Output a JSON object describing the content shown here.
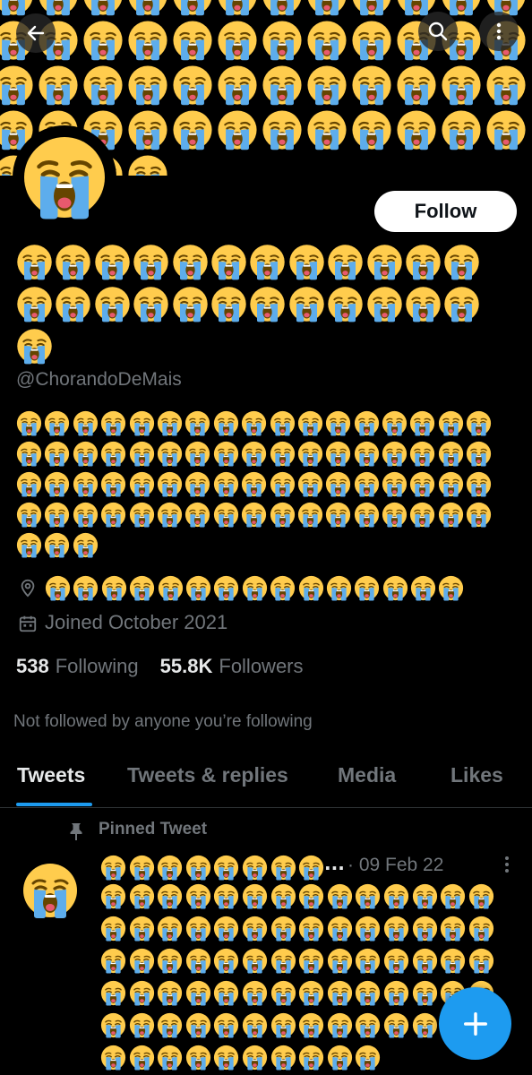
{
  "header": {
    "back_icon": "arrow-left-icon",
    "search_icon": "search-icon",
    "more_icon": "more-vertical-icon",
    "banner_emoji": "😭"
  },
  "profile": {
    "avatar_emoji": "😭",
    "follow_label": "Follow",
    "display_name": "😭😭😭😭😭😭😭😭😭😭😭😭😭😭😭😭😭😭😭😭😭😭😭😭😭",
    "handle": "@ChorandoDeMais",
    "bio": "😭😭😭😭😭😭😭😭😭😭😭😭😭😭😭😭😭😭😭😭😭😭😭😭😭😭😭😭😭😭😭😭😭😭😭😭😭😭😭😭😭😭😭😭😭😭😭😭😭😭😭😭😭😭😭😭😭😭😭😭😭😭😭😭😭😭😭😭😭😭😭",
    "location": "😭😭😭😭😭😭😭😭😭😭😭😭😭😭😭",
    "location_icon": "location-pin-icon",
    "joined": "Joined October 2021",
    "joined_icon": "calendar-icon",
    "following_count": "538",
    "following_label": "Following",
    "followers_count": "55.8K",
    "followers_label": "Followers",
    "not_followed_text": "Not followed by anyone you’re following"
  },
  "tabs": [
    {
      "label": "Tweets",
      "active": true
    },
    {
      "label": "Tweets & replies",
      "active": false
    },
    {
      "label": "Media",
      "active": false
    },
    {
      "label": "Likes",
      "active": false
    }
  ],
  "pinned_tweet": {
    "pinned_label": "Pinned Tweet",
    "pin_icon": "pin-icon",
    "avatar_emoji": "😭",
    "author_name": "😭😭😭😭😭😭😭😭",
    "handle_truncated": "...",
    "date": "· 09 Feb 22",
    "body": "😭😭😭😭😭😭😭😭😭😭😭😭😭😭😭😭😭😭😭😭😭😭😭😭😭😭😭😭😭😭😭😭😭😭😭😭😭😭😭😭😭😭😭😭😭😭😭😭😭😭😭😭😭😭😭😭😭😭😭😭😭😭😭😭😭😭😭😭😭😭😭😭😭😭😭😭😭😭😭😭"
  },
  "fab": {
    "icon": "plus-icon"
  },
  "colors": {
    "accent": "#1d9bf0",
    "background": "#000000",
    "secondary_text": "#71767b",
    "primary_text": "#e7e9ea"
  }
}
